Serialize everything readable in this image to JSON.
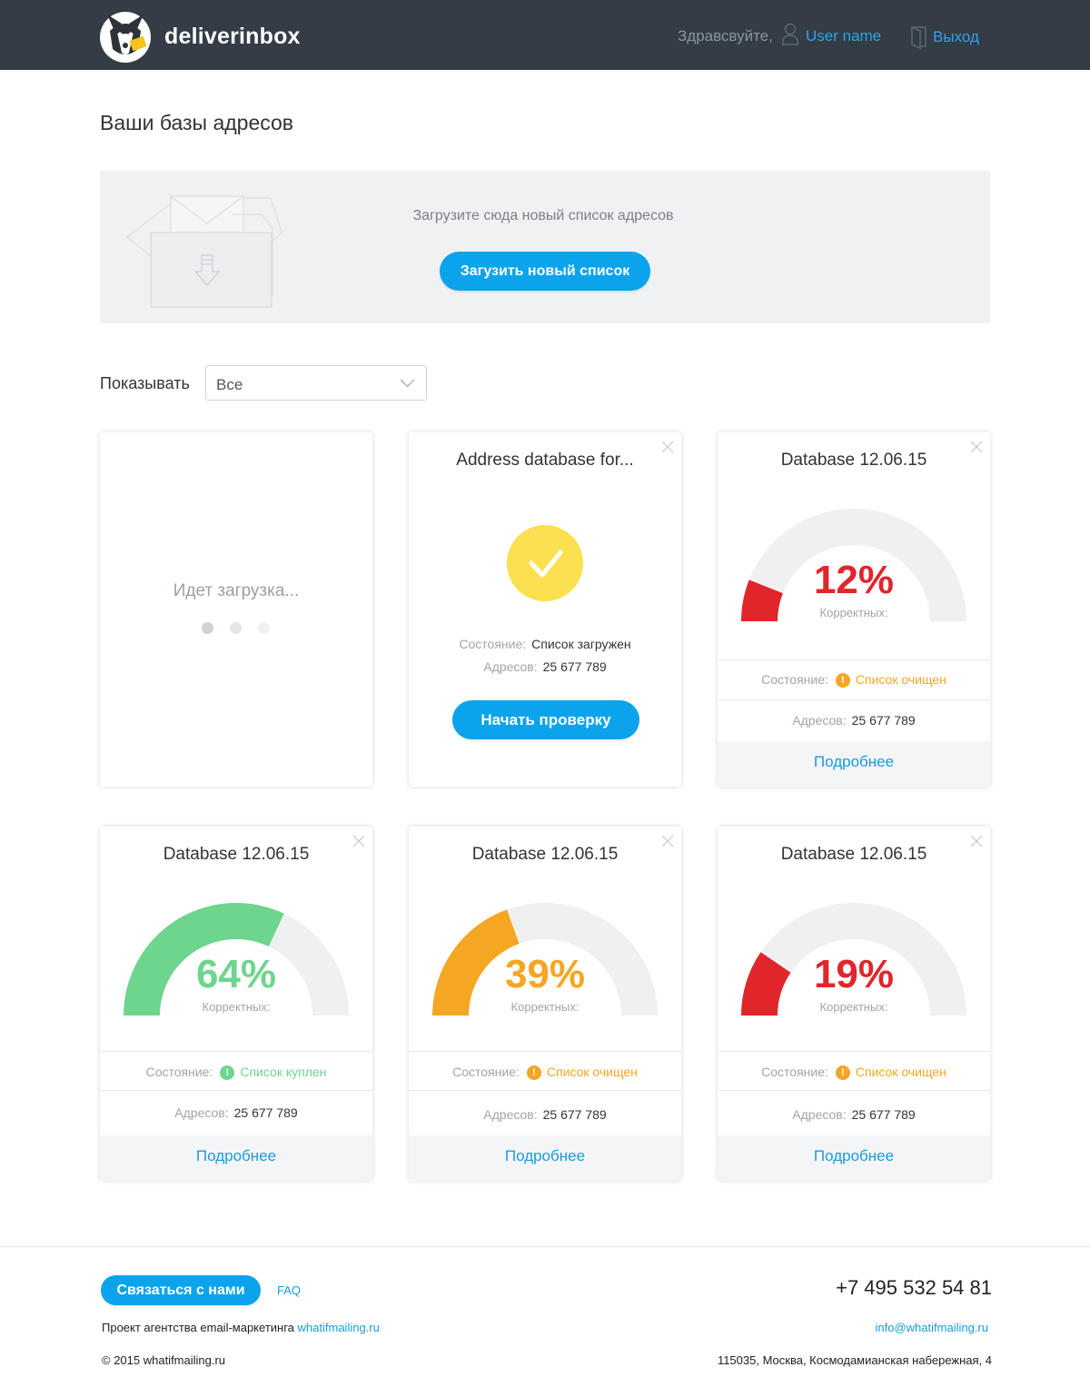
{
  "header": {
    "brand": "deliverinbox",
    "greeting": "Здравсвуйте,",
    "user_name": "User name",
    "logout": "Выход"
  },
  "page_title": "Ваши базы адресов",
  "upload": {
    "text": "Загрузите сюда новый список адресов",
    "button": "Загузить новый список"
  },
  "filter": {
    "label": "Показывать",
    "selected": "Все"
  },
  "cards": {
    "loading": {
      "text": "Идет загрузка..."
    },
    "uploaded": {
      "title": "Address database for...",
      "state_label": "Состояние:",
      "state_value": "Список загружен",
      "addr_label": "Адресов:",
      "addr_value": "25 677 789",
      "button": "Начать проверку"
    },
    "db1": {
      "title": "Database 12.06.15",
      "percent": 12,
      "percent_text": "12%",
      "sub": "Корректных:",
      "state_label": "Состояние:",
      "state_value": "Список очищен",
      "addr_label": "Адресов:",
      "addr_value": "25 677 789",
      "more": "Подробнее",
      "color": "#e0262b"
    },
    "db2": {
      "title": "Database 12.06.15",
      "percent": 64,
      "percent_text": "64%",
      "sub": "Корректных:",
      "state_label": "Состояние:",
      "state_value": "Список куплен",
      "addr_label": "Адресов:",
      "addr_value": "25 677 789",
      "more": "Подробнее",
      "color": "#6ed58e"
    },
    "db3": {
      "title": "Database 12.06.15",
      "percent": 39,
      "percent_text": "39%",
      "sub": "Корректных:",
      "state_label": "Состояние:",
      "state_value": "Список очищен",
      "addr_label": "Адресов:",
      "addr_value": "25 677 789",
      "more": "Подробнее",
      "color": "#f5a623"
    },
    "db4": {
      "title": "Database 12.06.15",
      "percent": 19,
      "percent_text": "19%",
      "sub": "Корректных:",
      "state_label": "Состояние:",
      "state_value": "Список очищен",
      "addr_label": "Адресов:",
      "addr_value": "25 677 789",
      "more": "Подробнее",
      "color": "#e0262b"
    }
  },
  "status_colors": {
    "warning": "#f5a623",
    "ok": "#6ed58e",
    "accent": "#0aa3ec"
  },
  "footer": {
    "contact_button": "Связаться с нами",
    "faq": "FAQ",
    "phone": "+7 495 532 54 81",
    "agency_text": "Проект агентства email-маркетинга",
    "agency_link": "whatifmailing.ru",
    "email": "info@whatifmailing.ru",
    "copyright": "© 2015 whatifmailing.ru",
    "address": "115035, Москва, Космодамианская набережная, 4"
  }
}
